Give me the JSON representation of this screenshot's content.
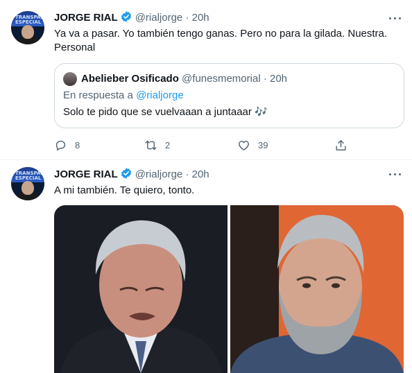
{
  "tweets": [
    {
      "author": {
        "name": "JORGE RIAL",
        "handle": "@rialjorge",
        "time": "20h",
        "avatar_text": "TRANSPARENCIA ESPECIAL"
      },
      "text": "Ya va a pasar. Yo también tengo ganas. Pero no para la gilada. Nuestra. Personal",
      "quote": {
        "author": {
          "name": "Abelieber Osificado",
          "handle": "@funesmemorial",
          "time": "20h"
        },
        "reply_prefix": "En respuesta a",
        "reply_to": "@rialjorge",
        "text": "Solo te pido que se vuelvaaan a juntaaar",
        "emoji": "🎶"
      },
      "actions": {
        "replies": "8",
        "retweets": "2",
        "likes": "39"
      }
    },
    {
      "author": {
        "name": "JORGE RIAL",
        "handle": "@rialjorge",
        "time": "20h",
        "avatar_text": "TRANSPARENCIA ESPECIAL"
      },
      "text": "A mi también. Te quiero, tonto.",
      "media": [
        {
          "icon": "photo-older-man-gray-hair-suit"
        },
        {
          "icon": "photo-man-gray-beard-denim-jacket"
        }
      ]
    }
  ],
  "colors": {
    "accent": "#1d9bf0",
    "secondary_text": "#536471",
    "text": "#0f1419",
    "border": "#cfd9de"
  },
  "icons": {
    "verified": "verified-badge-icon",
    "more": "more-icon",
    "reply": "reply-icon",
    "retweet": "retweet-icon",
    "like": "like-icon",
    "share": "share-icon"
  }
}
